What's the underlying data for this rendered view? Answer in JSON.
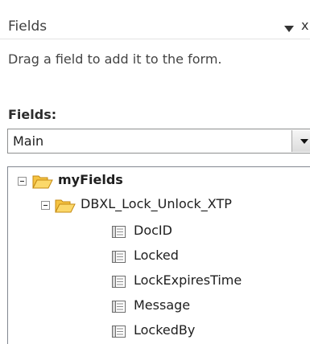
{
  "header": {
    "title": "Fields",
    "pane_menu_icon": "triangle-down-icon",
    "close_glyph": "x"
  },
  "hint_text": "Drag a field to add it to the form.",
  "fields_label": "Fields:",
  "data_source": {
    "selected": "Main",
    "dropdown_icon": "triangle-down-icon"
  },
  "tree": {
    "root": {
      "label": "myFields",
      "expanded": true,
      "icon": "folder-open-icon"
    },
    "group": {
      "label": "DBXL_Lock_Unlock_XTP",
      "expanded": true,
      "icon": "folder-open-icon"
    },
    "fields": [
      {
        "label": "DocID",
        "icon": "field-icon"
      },
      {
        "label": "Locked",
        "icon": "field-icon"
      },
      {
        "label": "LockExpiresTime",
        "icon": "field-icon"
      },
      {
        "label": "Message",
        "icon": "field-icon"
      },
      {
        "label": "LockedBy",
        "icon": "field-icon"
      }
    ]
  },
  "colors": {
    "folder": "#f5c342",
    "folder_dark": "#d79b12",
    "border": "#828790"
  }
}
